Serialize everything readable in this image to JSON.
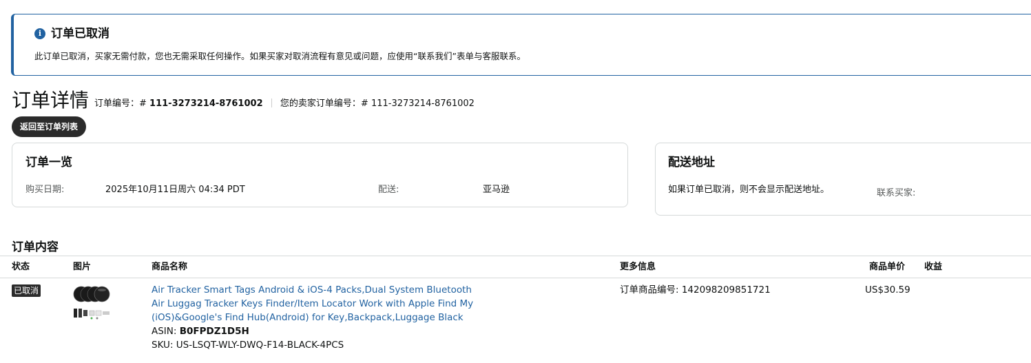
{
  "alert": {
    "title": "订单已取消",
    "body": "此订单已取消，买家无需付款，您也无需采取任何操作。如果买家对取消流程有意见或问题，应使用“联系我们”表单与客服联系。",
    "icon": "info-icon"
  },
  "header": {
    "title": "订单详情",
    "order_label": "订单编号：#",
    "order_number": "111-3273214-8761002",
    "seller_order_label": "您的卖家订单编号：#",
    "seller_order_number": "111-3273214-8761002",
    "back_button": "返回至订单列表"
  },
  "summary": {
    "title": "订单一览",
    "purchase_date_label": "购买日期:",
    "purchase_date": "2025年10月11日周六 04:34 PDT",
    "shipping_label": "配送:",
    "shipping_value": "亚马逊"
  },
  "shipping_address": {
    "title": "配送地址",
    "note": "如果订单已取消，则不会显示配送地址。",
    "contact_buyer_label": "联系买家:"
  },
  "contents": {
    "title": "订单内容",
    "columns": [
      "状态",
      "图片",
      "商品名称",
      "更多信息",
      "商品单价",
      "收益"
    ],
    "items": [
      {
        "status": "已取消",
        "name": "Air Tracker Smart Tags Android & iOS-4 Packs,Dual System Bluetooth Air Luggag Tracker Keys Finder/Item Locator Work with Apple Find My (iOS)&Google's Find Hub(Android) for Key,Backpack,Luggage Black",
        "asin_label": "ASIN:",
        "asin": "B0FPDZ1D5H",
        "sku": "SKU: US-LSQT-WLY-DWQ-F14-BLACK-4PCS",
        "more_info": "订单商品编号: 142098209851721",
        "unit_price": "US$30.59"
      }
    ]
  },
  "colors": {
    "accent": "#2162a1",
    "dark_button": "#2b2b2b",
    "border": "#d5d9d9"
  }
}
